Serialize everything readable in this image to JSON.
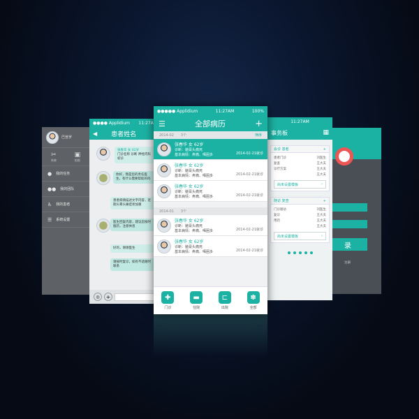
{
  "left_panel": {
    "user": "巴普罗",
    "icon_a": "系统",
    "icon_b": "拍照",
    "menu": [
      "我的任务",
      "我的团队",
      "我的患者",
      "系统设置"
    ]
  },
  "chat": {
    "status_left": "●●●● Applidium",
    "time": "11:27AM",
    "title": "患者姓名",
    "messages": [
      {
        "side": "left",
        "name": "张春华 女 62岁",
        "text": "门诊名称 诊断 神经内科 初诊"
      },
      {
        "side": "right",
        "text": "你好，我是您的责任医生，有什么需要帮助的吗"
      },
      {
        "side": "left",
        "text": "患者病情描述文字内容，近期头晕头痛症状加重"
      },
      {
        "side": "right",
        "text": "医生回复内容，建议您按时服药，注意休息"
      },
      {
        "side": "left",
        "text": "好的，谢谢医生"
      },
      {
        "side": "right",
        "text": "请按时复诊，如有不适随时联系"
      }
    ]
  },
  "main": {
    "carrier": "●●●●● Applidium",
    "time": "11:27AM",
    "battery": "100%",
    "title": "全部病历",
    "groups": [
      {
        "date": "2014-02",
        "count": "3个",
        "action": "筛序",
        "records": [
          {
            "name": "张春华 女 62岁",
            "l2": "诊断：脑膏头痛死",
            "l3": "基本病情：疼痛、哂困多",
            "date": "2014-02-21就诊",
            "selected": true
          },
          {
            "name": "张春华 女 62岁",
            "l2": "诊断：脑膏头痛死",
            "l3": "基本病情：疼痛、哂困多",
            "date": "2014-02-21就诊",
            "selected": false
          },
          {
            "name": "张春华 女 62岁",
            "l2": "诊断：脑膏头痛死",
            "l3": "基本病情：疼痛、哂困多",
            "date": "2014-02-21就诊",
            "selected": false
          }
        ]
      },
      {
        "date": "2014-01",
        "count": "3个",
        "action": "",
        "records": [
          {
            "name": "张春华 女 62岁",
            "l2": "诊断：脑膏头痛死",
            "l3": "基本病情：疼痛、哂困多",
            "date": "2014-02-21就诊",
            "selected": false
          },
          {
            "name": "张春华 女 62岁",
            "l2": "诊断：脑膏头痛死",
            "l3": "基本病情：疼痛、哂困多",
            "date": "2014-02-21就诊",
            "selected": false
          }
        ]
      }
    ],
    "tabs": [
      {
        "label": "门诊",
        "icon": "✚"
      },
      {
        "label": "住院",
        "icon": "▬"
      },
      {
        "label": "出院",
        "icon": "⊏"
      },
      {
        "label": "全部",
        "icon": "✽"
      }
    ]
  },
  "task": {
    "title": "事务板",
    "time": "11:27AM",
    "sections": [
      {
        "head": "会诊 患者",
        "lines": [
          [
            "患者门诊",
            "刘医生"
          ],
          [
            "复查",
            "王大夫"
          ],
          [
            "诊疗方案",
            "王大夫"
          ],
          [
            "",
            "王大夫"
          ]
        ],
        "button": "尚未设置模板"
      },
      {
        "head": "随访 复查",
        "lines": [
          [
            "门诊随访",
            "刘医生"
          ],
          [
            "复诊",
            "王大夫"
          ],
          [
            "用药",
            "王大夫"
          ],
          [
            "",
            "王大夫"
          ]
        ],
        "button": "尚未设置模板"
      }
    ]
  },
  "settings": {
    "button": "录",
    "link": "注册"
  },
  "colors": {
    "accent": "#1bb1a3",
    "background": "#050a14"
  }
}
